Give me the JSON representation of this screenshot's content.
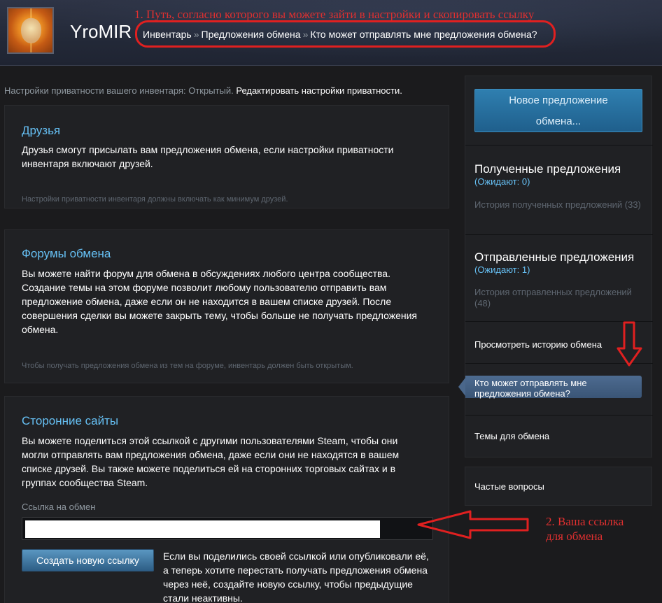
{
  "header": {
    "username": "YroMIR",
    "annotation_1": "1. Путь, согласно которого вы можете зайти в настройки и скопировать ссылку",
    "breadcrumb": [
      "Инвентарь",
      "Предложения обмена",
      "Кто может отправлять мне предложения обмена?"
    ],
    "separator": "»"
  },
  "privacy": {
    "text": "Настройки приватности вашего инвентаря: Открытый.",
    "link": "Редактировать настройки приватности."
  },
  "friends": {
    "title": "Друзья",
    "body": "Друзья смогут присылать вам предложения обмена, если настройки приватности инвентаря включают друзей.",
    "note": "Настройки приватности инвентаря должны включать как минимум друзей."
  },
  "forums": {
    "title": "Форумы обмена",
    "body": "Вы можете найти форум для обмена в обсуждениях любого центра сообщества. Создание темы на этом форуме позволит любому пользователю отправить вам предложение обмена, даже если он не находится в вашем списке друзей. После совершения сделки вы можете закрыть тему, чтобы больше не получать предложения обмена.",
    "note": "Чтобы получать предложения обмена из тем на форуме, инвентарь должен быть открытым."
  },
  "third_party": {
    "title": "Сторонние сайты",
    "body": "Вы можете поделиться этой ссылкой с другими пользователями Steam, чтобы они могли отправлять вам предложения обмена, даже если они не находятся в вашем списке друзей. Вы также можете поделиться ей на сторонних торговых сайтах и в группах сообщества Steam.",
    "link_label": "Ссылка на обмен",
    "link_value": "",
    "new_link_button": "Создать новую ссылку",
    "new_link_text": "Если вы поделились своей ссылкой или опубликовали её, а теперь хотите перестать получать предложения обмена через неё, создайте новую ссылку, чтобы предыдущие стали неактивны."
  },
  "sidebar": {
    "new_offer_line1": "Новое предложение",
    "new_offer_line2": "обмена...",
    "received_title": "Полученные предложения",
    "received_pending": "(Ожидают: 0)",
    "received_history": "История полученных предложений (33)",
    "sent_title": "Отправленные предложения",
    "sent_pending": "(Ожидают: 1)",
    "sent_history": "История отправленных предложений (48)",
    "trade_history": "Просмотреть историю обмена",
    "who_can_send_line1": "Кто может отправлять мне",
    "who_can_send_line2": "предложения обмена?",
    "trade_topics": "Темы для обмена",
    "faq": "Частые вопросы"
  },
  "annotation_2": {
    "line1": "2. Ваша ссылка",
    "line2": "для обмена"
  },
  "colors": {
    "annotation": "#e03030",
    "accent_blue": "#66c0f4",
    "panel_bg": "#202124",
    "page_bg": "#1b1b1d"
  }
}
